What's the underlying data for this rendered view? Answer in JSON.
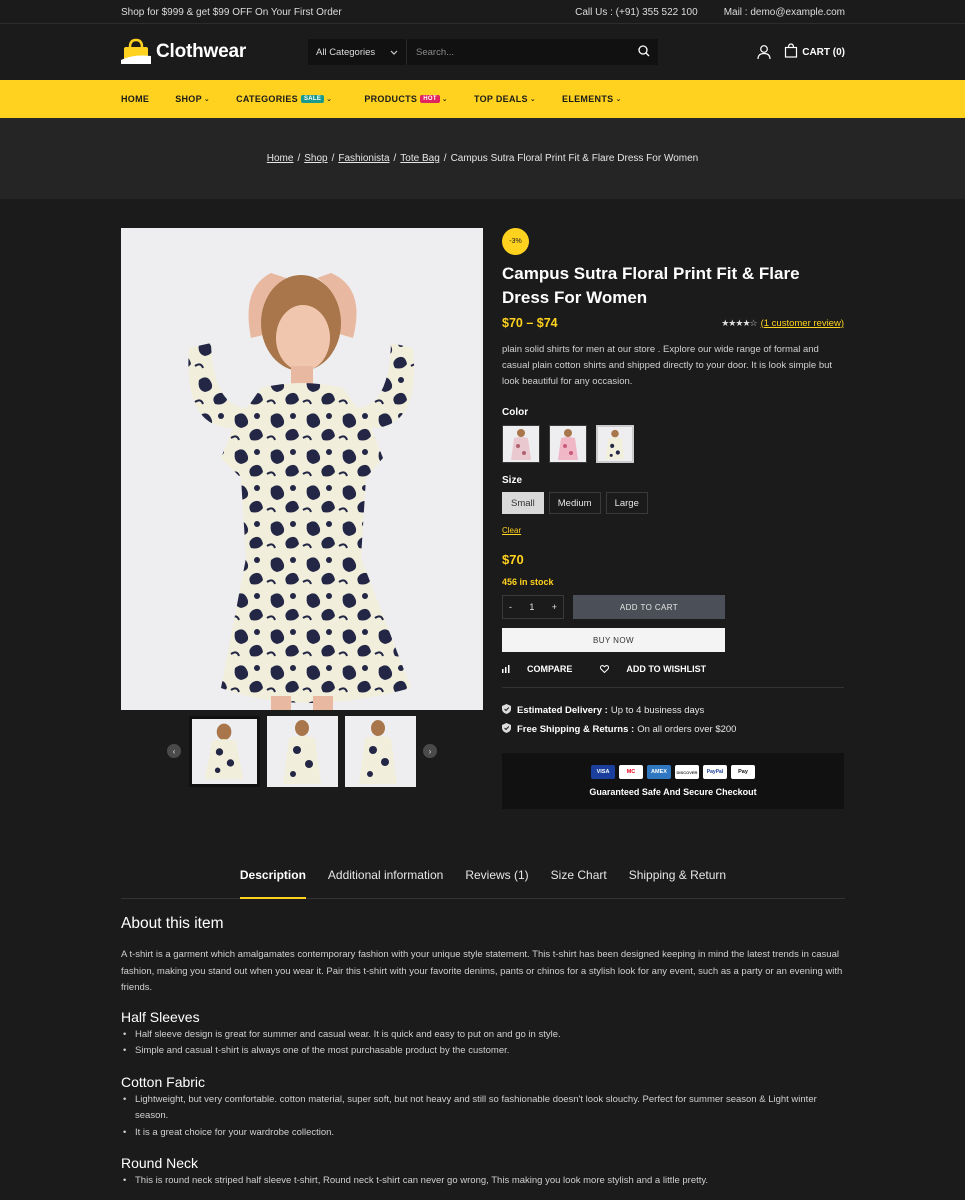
{
  "topbar": {
    "promo": "Shop for $999 & get $99 OFF On Your First Order",
    "call": "Call Us : (+91) 355 522 100",
    "mail": "Mail : demo@example.com"
  },
  "header": {
    "logo": "Clothwear",
    "category": "All Categories",
    "search_placeholder": "Search...",
    "cart": "CART (0)"
  },
  "nav": {
    "items": [
      {
        "label": "HOME"
      },
      {
        "label": "SHOP",
        "chevron": "⌄"
      },
      {
        "label": "CATEGORIES",
        "badge": "SALE",
        "chevron": "⌄"
      },
      {
        "label": "PRODUCTS",
        "badge": "HOT",
        "chevron": "⌄"
      },
      {
        "label": "TOP DEALS",
        "chevron": "⌄"
      },
      {
        "label": "ELEMENTS",
        "chevron": "⌄"
      }
    ]
  },
  "breadcrumb": {
    "items": [
      "Home",
      "Shop",
      "Fashionista",
      "Tote Bag"
    ],
    "current": "Campus Sutra Floral Print Fit & Flare Dress For Women"
  },
  "product": {
    "discount": "-3%",
    "title": "Campus Sutra Floral Print Fit & Flare Dress For Women",
    "price_range": "$70 – $74",
    "stars": "★★★★☆",
    "rating_value": 4,
    "review_link": "(1 customer review)",
    "description": "plain solid shirts for men at our store . Explore our wide range of formal and casual plain cotton shirts and shipped directly to your door. It is look simple but look beautiful for any occasion.",
    "color_label": "Color",
    "size_label": "Size",
    "sizes": [
      "Small",
      "Medium",
      "Large"
    ],
    "selected_size": "Small",
    "clear": "Clear",
    "price": "$70",
    "stock": "456 in stock",
    "qty": "1",
    "qty_minus": "-",
    "qty_plus": "+",
    "add_to_cart": "ADD TO CART",
    "buy_now": "BUY NOW",
    "compare": "COMPARE",
    "wishlist": "ADD TO WISHLIST",
    "delivery_label": "Estimated Delivery :",
    "delivery_value": "Up to 4 business days",
    "shipping_label": "Free Shipping & Returns :",
    "shipping_value": "On all orders over $200",
    "payment_cards": [
      "VISA",
      "MC",
      "AMEX",
      "DISCOVER",
      "PayPal",
      "Pay"
    ],
    "secure": "Guaranteed Safe And Secure Checkout"
  },
  "tabs": [
    "Description",
    "Additional information",
    "Reviews (1)",
    "Size Chart",
    "Shipping & Return"
  ],
  "content": {
    "about_title": "About this item",
    "about_text": "A t-shirt is a garment which amalgamates contemporary fashion with your unique style statement. This t-shirt has been designed keeping in mind the latest trends in casual fashion, making you stand out when you wear it. Pair this t-shirt with your favorite denims, pants or chinos for a stylish look for any event, such as a party or an evening with friends.",
    "sections": [
      {
        "title": "Half Sleeves",
        "bullets": [
          "Half sleeve design is great for summer and casual wear. It is quick and easy to put on and go in style.",
          "Simple and casual t-shirt is always one of the most purchasable product by the customer."
        ]
      },
      {
        "title": "Cotton Fabric",
        "bullets": [
          "Lightweight, but very comfortable. cotton material, super soft, but not heavy and still so fashionable doesn't look slouchy. Perfect for summer season & Light winter season.",
          "It is a great choice for your wardrobe collection."
        ]
      },
      {
        "title": "Round Neck",
        "bullets": [
          "This is round neck striped half sleeve t-shirt, Round neck t-shirt can never go wrong, This making you look more stylish and a little pretty."
        ]
      }
    ]
  },
  "colors": {
    "accent": "#ffd21f",
    "background": "#1b1b1b",
    "sale_badge": "#1a9a8c",
    "hot_badge": "#e0245e"
  }
}
